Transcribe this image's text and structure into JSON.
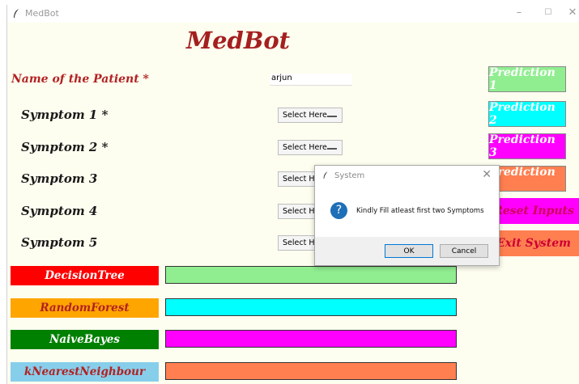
{
  "window": {
    "title": "MedBot",
    "controls": {
      "minimize": "–",
      "maximize": "☐",
      "close": "✕"
    }
  },
  "heading": "MedBot",
  "patient": {
    "label": "Name of the Patient *",
    "value": "arjun"
  },
  "symptoms": [
    {
      "label": "Symptom 1 *",
      "select": "Select Here"
    },
    {
      "label": "Symptom 2 *",
      "select": "Select Here"
    },
    {
      "label": "Symptom 3",
      "select": "Select Here"
    },
    {
      "label": "Symptom 4",
      "select": "Select Here"
    },
    {
      "label": "Symptom 5",
      "select": "Select Here"
    }
  ],
  "buttons": {
    "prediction1": "Prediction 1",
    "prediction2": "Prediction 2",
    "prediction3": "Prediction 3",
    "prediction4": "Prediction 4",
    "reset": "Reset Inputs",
    "exit": "Exit System"
  },
  "algorithms": {
    "decision_tree": "DecisionTree",
    "random_forest": "RandomForest",
    "naive_bayes": "NaiveBayes",
    "knn": "kNearestNeighbour"
  },
  "dialog": {
    "title": "System",
    "icon": "question-icon",
    "icon_glyph": "?",
    "message": "Kindly Fill atleast first two Symptoms",
    "ok": "OK",
    "cancel": "Cancel",
    "close": "✕"
  },
  "colors": {
    "prediction1": "#90ee90",
    "prediction2": "#00ffff",
    "prediction3": "#ff00ff",
    "prediction4": "#ff7f50",
    "reset": "#ff00ff",
    "exit": "#ff7f50",
    "decision_tree": "#ff0000",
    "random_forest": "#ffa500",
    "naive_bayes": "#008000",
    "knn": "#87ceeb"
  }
}
